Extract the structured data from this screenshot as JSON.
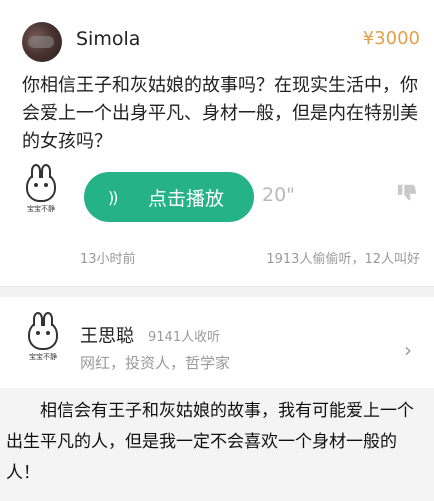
{
  "question": {
    "asker_name": "Simola",
    "price": "¥3000",
    "text": "你相信王子和灰姑娘的故事吗？在现实生活中，你会爱上一个出身平凡、身材一般，但是内在特别美的女孩吗？"
  },
  "voice": {
    "play_label": "点击播放",
    "duration": "20\"",
    "icon_wave": "wave-icon",
    "icon_thumb": "thumbs-down-icon"
  },
  "meta": {
    "time_ago": "13小时前",
    "stats": "1913人偷偷听，12人叫好"
  },
  "mascot": {
    "caption": "宝宝不静"
  },
  "answerer": {
    "name": "王思聪",
    "listeners": "9141人收听",
    "title": "网红，投资人，哲学家"
  },
  "answer": {
    "text": "相信会有王子和灰姑娘的故事，我有可能爱上一个出生平凡的人，但是我一定不会喜欢一个身材一般的人！"
  },
  "colors": {
    "accent_green": "#25b385",
    "price_orange": "#e3a04a"
  }
}
